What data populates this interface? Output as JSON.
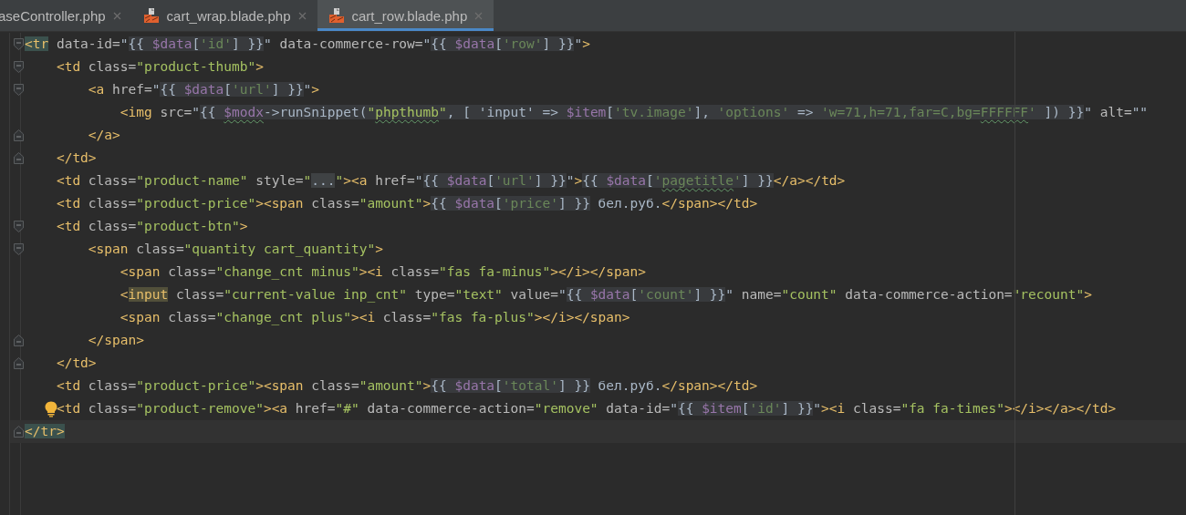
{
  "tabs": [
    {
      "label": "aseController.php",
      "icon": false,
      "selected": false
    },
    {
      "label": "cart_wrap.blade.php",
      "icon": true,
      "selected": false
    },
    {
      "label": "cart_row.blade.php",
      "icon": true,
      "selected": true
    }
  ],
  "lines": [
    {
      "kind": "fold_start",
      "tokens": [
        {
          "kind": "tag",
          "t": "<tr",
          "matched": true
        },
        {
          "kind": "attr",
          "t": " data-id="
        },
        {
          "kind": "plain",
          "t": "\""
        },
        {
          "kind": "plain",
          "t": "{{ ",
          "injected": true
        },
        {
          "kind": "variable",
          "t": "$data",
          "injected": true
        },
        {
          "kind": "plain",
          "t": "[",
          "injected": true
        },
        {
          "kind": "key",
          "t": "'id'",
          "injected": true
        },
        {
          "kind": "plain",
          "t": "] }}",
          "injected": true
        },
        {
          "kind": "plain",
          "t": "\""
        },
        {
          "kind": "attr",
          "t": " data-commerce-row="
        },
        {
          "kind": "plain",
          "t": "\""
        },
        {
          "kind": "plain",
          "t": "{{ ",
          "injected": true
        },
        {
          "kind": "variable",
          "t": "$data",
          "injected": true
        },
        {
          "kind": "plain",
          "t": "[",
          "injected": true
        },
        {
          "kind": "key",
          "t": "'row'",
          "injected": true
        },
        {
          "kind": "plain",
          "t": "] }}",
          "injected": true
        },
        {
          "kind": "plain",
          "t": "\""
        },
        {
          "kind": "tag",
          "t": ">"
        }
      ]
    },
    {
      "kind": "fold_start",
      "tokens": [
        {
          "kind": "tag",
          "t": "    <td"
        },
        {
          "kind": "attr",
          "t": " class="
        },
        {
          "kind": "string",
          "t": "\"product-thumb\""
        },
        {
          "kind": "tag",
          "t": ">"
        }
      ]
    },
    {
      "kind": "fold_start",
      "tokens": [
        {
          "kind": "tag",
          "t": "        <a"
        },
        {
          "kind": "attr",
          "t": " href="
        },
        {
          "kind": "plain",
          "t": "\""
        },
        {
          "kind": "plain",
          "t": "{{ ",
          "injected": true
        },
        {
          "kind": "variable",
          "t": "$data",
          "injected": true
        },
        {
          "kind": "plain",
          "t": "[",
          "injected": true
        },
        {
          "kind": "key",
          "t": "'url'",
          "injected": true
        },
        {
          "kind": "plain",
          "t": "] }}",
          "injected": true
        },
        {
          "kind": "plain",
          "t": "\""
        },
        {
          "kind": "tag",
          "t": ">"
        }
      ]
    },
    {
      "kind": "plain",
      "tokens": [
        {
          "kind": "tag",
          "t": "            <img"
        },
        {
          "kind": "attr",
          "t": " src="
        },
        {
          "kind": "plain",
          "t": "\""
        },
        {
          "kind": "plain",
          "t": "{{ ",
          "injected": true
        },
        {
          "kind": "variable",
          "t": "$modx",
          "injected": true,
          "typo": true
        },
        {
          "kind": "plain",
          "t": "->runSnippet(",
          "injected": true
        },
        {
          "kind": "string",
          "t": "\"",
          "injected": true
        },
        {
          "kind": "string",
          "t": "phpthumb",
          "injected": true,
          "typo": true
        },
        {
          "kind": "string",
          "t": "\"",
          "injected": true
        },
        {
          "kind": "plain",
          "t": ", [ ",
          "injected": true
        },
        {
          "kind": "plain",
          "t": "'input'",
          "injected": true
        },
        {
          "kind": "plain",
          "t": " => ",
          "injected": true
        },
        {
          "kind": "variable",
          "t": "$item",
          "injected": true
        },
        {
          "kind": "plain",
          "t": "[",
          "injected": true
        },
        {
          "kind": "key",
          "t": "'tv.image'",
          "injected": true
        },
        {
          "kind": "plain",
          "t": "], ",
          "injected": true
        },
        {
          "kind": "key",
          "t": "'options'",
          "injected": true
        },
        {
          "kind": "plain",
          "t": " => ",
          "injected": true
        },
        {
          "kind": "key",
          "t": "'w=71,h=71,far=C,bg=",
          "injected": true
        },
        {
          "kind": "key",
          "t": "FFFFFF",
          "injected": true,
          "typo": true
        },
        {
          "kind": "key",
          "t": "'",
          "injected": true
        },
        {
          "kind": "plain",
          "t": " ]) }}",
          "injected": true
        },
        {
          "kind": "plain",
          "t": "\""
        },
        {
          "kind": "attr",
          "t": " alt="
        },
        {
          "kind": "plain",
          "t": "\"\""
        }
      ]
    },
    {
      "kind": "fold_end",
      "tokens": [
        {
          "kind": "tag",
          "t": "        </a>"
        }
      ]
    },
    {
      "kind": "fold_end",
      "tokens": [
        {
          "kind": "tag",
          "t": "    </td>"
        }
      ]
    },
    {
      "kind": "plain",
      "tokens": [
        {
          "kind": "tag",
          "t": "    <td"
        },
        {
          "kind": "attr",
          "t": " class="
        },
        {
          "kind": "string",
          "t": "\"product-name\""
        },
        {
          "kind": "attr",
          "t": " style="
        },
        {
          "kind": "string",
          "t": "\""
        },
        {
          "kind": "plain",
          "t": "...",
          "folded": true
        },
        {
          "kind": "string",
          "t": "\""
        },
        {
          "kind": "tag",
          "t": "><a"
        },
        {
          "kind": "attr",
          "t": " href="
        },
        {
          "kind": "plain",
          "t": "\""
        },
        {
          "kind": "plain",
          "t": "{{ ",
          "injected": true
        },
        {
          "kind": "variable",
          "t": "$data",
          "injected": true
        },
        {
          "kind": "plain",
          "t": "[",
          "injected": true
        },
        {
          "kind": "key",
          "t": "'url'",
          "injected": true
        },
        {
          "kind": "plain",
          "t": "] }}",
          "injected": true
        },
        {
          "kind": "plain",
          "t": "\""
        },
        {
          "kind": "tag",
          "t": ">"
        },
        {
          "kind": "plain",
          "t": "{{ ",
          "injected": true
        },
        {
          "kind": "variable",
          "t": "$data",
          "injected": true
        },
        {
          "kind": "plain",
          "t": "[",
          "injected": true
        },
        {
          "kind": "key",
          "t": "'",
          "injected": true
        },
        {
          "kind": "key",
          "t": "pagetitle",
          "injected": true,
          "typo": true
        },
        {
          "kind": "key",
          "t": "'",
          "injected": true
        },
        {
          "kind": "plain",
          "t": "] }}",
          "injected": true
        },
        {
          "kind": "tag",
          "t": "</a></td>"
        }
      ]
    },
    {
      "kind": "plain",
      "tokens": [
        {
          "kind": "tag",
          "t": "    <td"
        },
        {
          "kind": "attr",
          "t": " class="
        },
        {
          "kind": "string",
          "t": "\"product-price\""
        },
        {
          "kind": "tag",
          "t": "><span"
        },
        {
          "kind": "attr",
          "t": " class="
        },
        {
          "kind": "string",
          "t": "\"amount\""
        },
        {
          "kind": "tag",
          "t": ">"
        },
        {
          "kind": "plain",
          "t": "{{ ",
          "injected": true
        },
        {
          "kind": "variable",
          "t": "$data",
          "injected": true
        },
        {
          "kind": "plain",
          "t": "[",
          "injected": true
        },
        {
          "kind": "key",
          "t": "'price'",
          "injected": true
        },
        {
          "kind": "plain",
          "t": "] }}",
          "injected": true
        },
        {
          "kind": "plain",
          "t": " бел.руб."
        },
        {
          "kind": "tag",
          "t": "</span></td>"
        }
      ]
    },
    {
      "kind": "fold_start",
      "tokens": [
        {
          "kind": "tag",
          "t": "    <td"
        },
        {
          "kind": "attr",
          "t": " class="
        },
        {
          "kind": "string",
          "t": "\"product-btn\""
        },
        {
          "kind": "tag",
          "t": ">"
        }
      ]
    },
    {
      "kind": "fold_start",
      "tokens": [
        {
          "kind": "tag",
          "t": "        <span"
        },
        {
          "kind": "attr",
          "t": " class="
        },
        {
          "kind": "string",
          "t": "\"quantity cart_quantity\""
        },
        {
          "kind": "tag",
          "t": ">"
        }
      ]
    },
    {
      "kind": "plain",
      "tokens": [
        {
          "kind": "tag",
          "t": "            <span"
        },
        {
          "kind": "attr",
          "t": " class="
        },
        {
          "kind": "string",
          "t": "\"change_cnt minus\""
        },
        {
          "kind": "tag",
          "t": "><i"
        },
        {
          "kind": "attr",
          "t": " class="
        },
        {
          "kind": "string",
          "t": "\"fas fa-minus\""
        },
        {
          "kind": "tag",
          "t": "></i></span>"
        }
      ]
    },
    {
      "kind": "plain",
      "tokens": [
        {
          "kind": "tag",
          "t": "            <"
        },
        {
          "kind": "tag",
          "t": "input",
          "usage": true
        },
        {
          "kind": "attr",
          "t": " class="
        },
        {
          "kind": "string",
          "t": "\"current-value inp_cnt\""
        },
        {
          "kind": "attr",
          "t": " type="
        },
        {
          "kind": "string",
          "t": "\"text\""
        },
        {
          "kind": "attr",
          "t": " value="
        },
        {
          "kind": "plain",
          "t": "\""
        },
        {
          "kind": "plain",
          "t": "{{ ",
          "injected": true
        },
        {
          "kind": "variable",
          "t": "$data",
          "injected": true
        },
        {
          "kind": "plain",
          "t": "[",
          "injected": true
        },
        {
          "kind": "key",
          "t": "'count'",
          "injected": true
        },
        {
          "kind": "plain",
          "t": "] }}",
          "injected": true
        },
        {
          "kind": "plain",
          "t": "\""
        },
        {
          "kind": "attr",
          "t": " name="
        },
        {
          "kind": "string",
          "t": "\"count\""
        },
        {
          "kind": "attr",
          "t": " data-commerce-action="
        },
        {
          "kind": "string",
          "t": "\"recount\""
        },
        {
          "kind": "tag",
          "t": ">"
        }
      ]
    },
    {
      "kind": "plain",
      "tokens": [
        {
          "kind": "tag",
          "t": "            <span"
        },
        {
          "kind": "attr",
          "t": " class="
        },
        {
          "kind": "string",
          "t": "\"change_cnt plus\""
        },
        {
          "kind": "tag",
          "t": "><i"
        },
        {
          "kind": "attr",
          "t": " class="
        },
        {
          "kind": "string",
          "t": "\"fas fa-plus\""
        },
        {
          "kind": "tag",
          "t": "></i></span>"
        }
      ]
    },
    {
      "kind": "fold_end",
      "tokens": [
        {
          "kind": "tag",
          "t": "        </span>"
        }
      ]
    },
    {
      "kind": "fold_end",
      "tokens": [
        {
          "kind": "tag",
          "t": "    </td>"
        }
      ]
    },
    {
      "kind": "plain",
      "tokens": [
        {
          "kind": "tag",
          "t": "    <td"
        },
        {
          "kind": "attr",
          "t": " class="
        },
        {
          "kind": "string",
          "t": "\"product-price\""
        },
        {
          "kind": "tag",
          "t": "><span"
        },
        {
          "kind": "attr",
          "t": " class="
        },
        {
          "kind": "string",
          "t": "\"amount\""
        },
        {
          "kind": "tag",
          "t": ">"
        },
        {
          "kind": "plain",
          "t": "{{ ",
          "injected": true
        },
        {
          "kind": "variable",
          "t": "$data",
          "injected": true
        },
        {
          "kind": "plain",
          "t": "[",
          "injected": true
        },
        {
          "kind": "key",
          "t": "'total'",
          "injected": true
        },
        {
          "kind": "plain",
          "t": "] }}",
          "injected": true
        },
        {
          "kind": "plain",
          "t": " бел.руб."
        },
        {
          "kind": "tag",
          "t": "</span></td>"
        }
      ]
    },
    {
      "kind": "plain",
      "hint": true,
      "tokens": [
        {
          "kind": "tag",
          "t": "    <td"
        },
        {
          "kind": "attr",
          "t": " class="
        },
        {
          "kind": "string",
          "t": "\"product-remove\""
        },
        {
          "kind": "tag",
          "t": "><a"
        },
        {
          "kind": "attr",
          "t": " href="
        },
        {
          "kind": "string",
          "t": "\"#\""
        },
        {
          "kind": "attr",
          "t": " data-commerce-action="
        },
        {
          "kind": "string",
          "t": "\"remove\""
        },
        {
          "kind": "attr",
          "t": " data-id="
        },
        {
          "kind": "plain",
          "t": "\""
        },
        {
          "kind": "plain",
          "t": "{{ ",
          "injected": true
        },
        {
          "kind": "variable",
          "t": "$item",
          "injected": true
        },
        {
          "kind": "plain",
          "t": "[",
          "injected": true
        },
        {
          "kind": "key",
          "t": "'id'",
          "injected": true
        },
        {
          "kind": "plain",
          "t": "] }}",
          "injected": true
        },
        {
          "kind": "plain",
          "t": "\""
        },
        {
          "kind": "tag",
          "t": "><i"
        },
        {
          "kind": "attr",
          "t": " class="
        },
        {
          "kind": "string",
          "t": "\"fa fa-times\""
        },
        {
          "kind": "tag",
          "t": "></i></a></td>"
        }
      ]
    },
    {
      "kind": "fold_end",
      "current": true,
      "tokens": [
        {
          "kind": "tag",
          "t": "</tr>",
          "matched": true
        }
      ]
    }
  ]
}
